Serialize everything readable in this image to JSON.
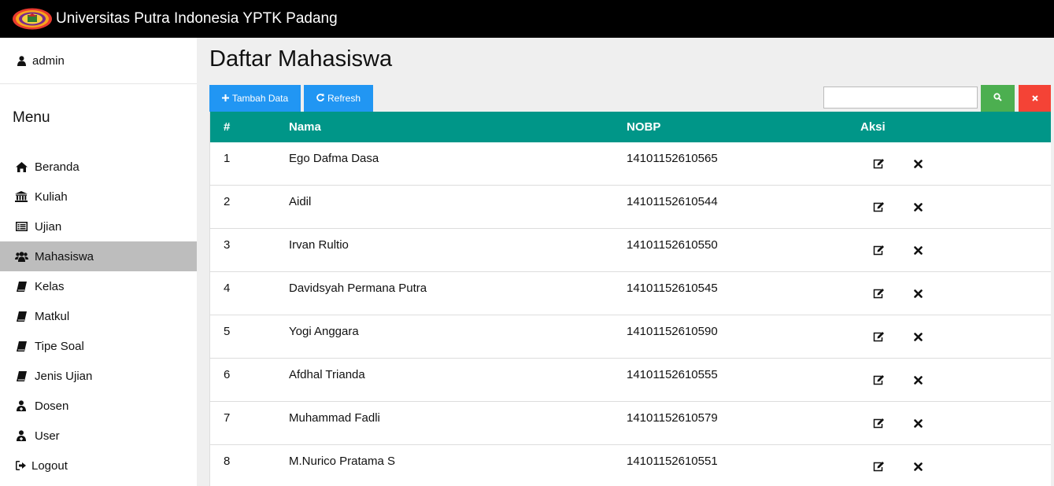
{
  "header": {
    "title": "Universitas Putra Indonesia YPTK Padang"
  },
  "sidebar": {
    "user": "admin",
    "menu_title": "Menu",
    "items": [
      {
        "label": "Beranda",
        "icon": "home-icon"
      },
      {
        "label": "Kuliah",
        "icon": "bank-icon"
      },
      {
        "label": "Ujian",
        "icon": "list-icon"
      },
      {
        "label": "Mahasiswa",
        "icon": "users-icon",
        "active": true
      },
      {
        "label": "Kelas",
        "icon": "book-icon"
      },
      {
        "label": "Matkul",
        "icon": "book-icon"
      },
      {
        "label": "Tipe Soal",
        "icon": "book-icon"
      },
      {
        "label": "Jenis Ujian",
        "icon": "book-icon"
      },
      {
        "label": "Dosen",
        "icon": "user-md-icon"
      },
      {
        "label": "User",
        "icon": "user-md-icon"
      },
      {
        "label": "Logout",
        "icon": "sign-out-icon"
      }
    ]
  },
  "main": {
    "title": "Daftar Mahasiswa",
    "add_label": "Tambah Data",
    "refresh_label": "Refresh",
    "search_placeholder": ""
  },
  "table": {
    "columns": [
      "#",
      "Nama",
      "NOBP",
      "Aksi"
    ],
    "rows": [
      {
        "no": "1",
        "nama": "Ego Dafma Dasa",
        "nobp": "14101152610565"
      },
      {
        "no": "2",
        "nama": "Aidil",
        "nobp": "14101152610544"
      },
      {
        "no": "3",
        "nama": "Irvan Rultio",
        "nobp": "14101152610550"
      },
      {
        "no": "4",
        "nama": "Davidsyah Permana Putra",
        "nobp": "14101152610545"
      },
      {
        "no": "5",
        "nama": "Yogi Anggara",
        "nobp": "14101152610590"
      },
      {
        "no": "6",
        "nama": "Afdhal Trianda",
        "nobp": "14101152610555"
      },
      {
        "no": "7",
        "nama": "Muhammad Fadli",
        "nobp": "14101152610579"
      },
      {
        "no": "8",
        "nama": "M.Nurico Pratama S",
        "nobp": "14101152610551"
      }
    ]
  },
  "colors": {
    "topbar": "#000000",
    "table_header": "#009688",
    "primary_button": "#2196f3",
    "search_button": "#4caf50",
    "clear_button": "#f44336",
    "active_nav": "#bdbdbd"
  }
}
